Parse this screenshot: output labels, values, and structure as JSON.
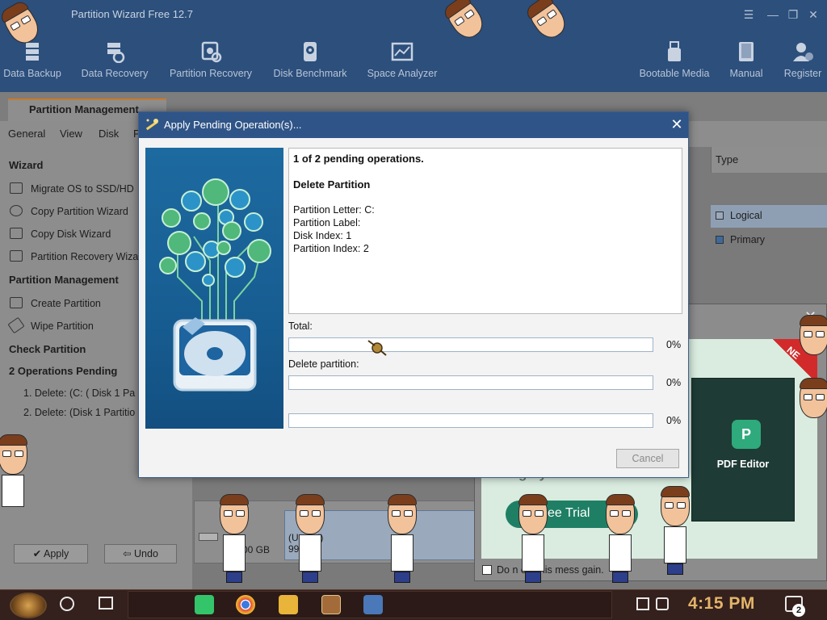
{
  "app": {
    "title": "Partition Wizard Free 12.7",
    "toolbar": [
      {
        "label": "Data Backup",
        "icon": "data-backup-icon"
      },
      {
        "label": "Data Recovery",
        "icon": "data-recovery-icon"
      },
      {
        "label": "Partition Recovery",
        "icon": "partition-recovery-icon"
      },
      {
        "label": "Disk Benchmark",
        "icon": "disk-benchmark-icon"
      },
      {
        "label": "Space Analyzer",
        "icon": "space-analyzer-icon"
      },
      {
        "label": "Bootable Media",
        "icon": "bootable-media-icon"
      },
      {
        "label": "Manual",
        "icon": "manual-icon"
      },
      {
        "label": "Register",
        "icon": "register-icon"
      }
    ],
    "tab": "Partition Management",
    "menus": [
      "General",
      "View",
      "Disk",
      "P"
    ],
    "sidebar": {
      "wizard_head": "Wizard",
      "wizard_items": [
        "Migrate OS to SSD/HD",
        "Copy Partition Wizard",
        "Copy Disk Wizard",
        "Partition Recovery Wiza"
      ],
      "pm_head": "Partition Management",
      "pm_items": [
        "Create Partition",
        "Wipe Partition"
      ],
      "check_head": "Check Partition",
      "pending_head": "2 Operations Pending",
      "pending_items": [
        "1. Delete: (C: ( Disk 1 Pa",
        "2. Delete: (Disk 1 Partitio"
      ],
      "apply": "Apply",
      "undo": "Undo",
      "apply_icon": "check-icon",
      "undo_icon": "undo-arrow-icon"
    },
    "table": {
      "type_header": "Type",
      "rows": [
        {
          "type": "Logical",
          "color": "#9aa9bb"
        },
        {
          "type": "Primary",
          "color": "#3d6a9c"
        }
      ]
    },
    "diskmap": {
      "size": "00 GB",
      "unalloc_label": "(U      ated)",
      "unalloc_size": "99"
    }
  },
  "dialog": {
    "title": "Apply Pending Operation(s)...",
    "count_text": "1 of 2 pending operations.",
    "operation": "Delete Partition",
    "details": [
      "Partition Letter: C:",
      "Partition Label:",
      "Disk Index: 1",
      "Partition Index: 2"
    ],
    "progress": [
      {
        "label": "Total:",
        "percent_text": "0%",
        "value": 0
      },
      {
        "label": "Delete partition:",
        "percent_text": "0%",
        "value": 0
      },
      {
        "label": "",
        "percent_text": "0%",
        "value": 0
      }
    ],
    "cancel": "Cancel"
  },
  "ad": {
    "tagline": "Sign your PDF files.",
    "trial_button": "ee Trial",
    "product": "PDF Editor",
    "badge": "NE",
    "dont_show": "Do n     ow this mess     gain."
  },
  "taskbar": {
    "time": "4:15 PM",
    "notification_count": "2"
  },
  "colors": {
    "titlebar": "#2c4f7c",
    "dialog_title": "#2f5487",
    "ad_green": "#1f7f64",
    "clock": "#e3b46a"
  }
}
